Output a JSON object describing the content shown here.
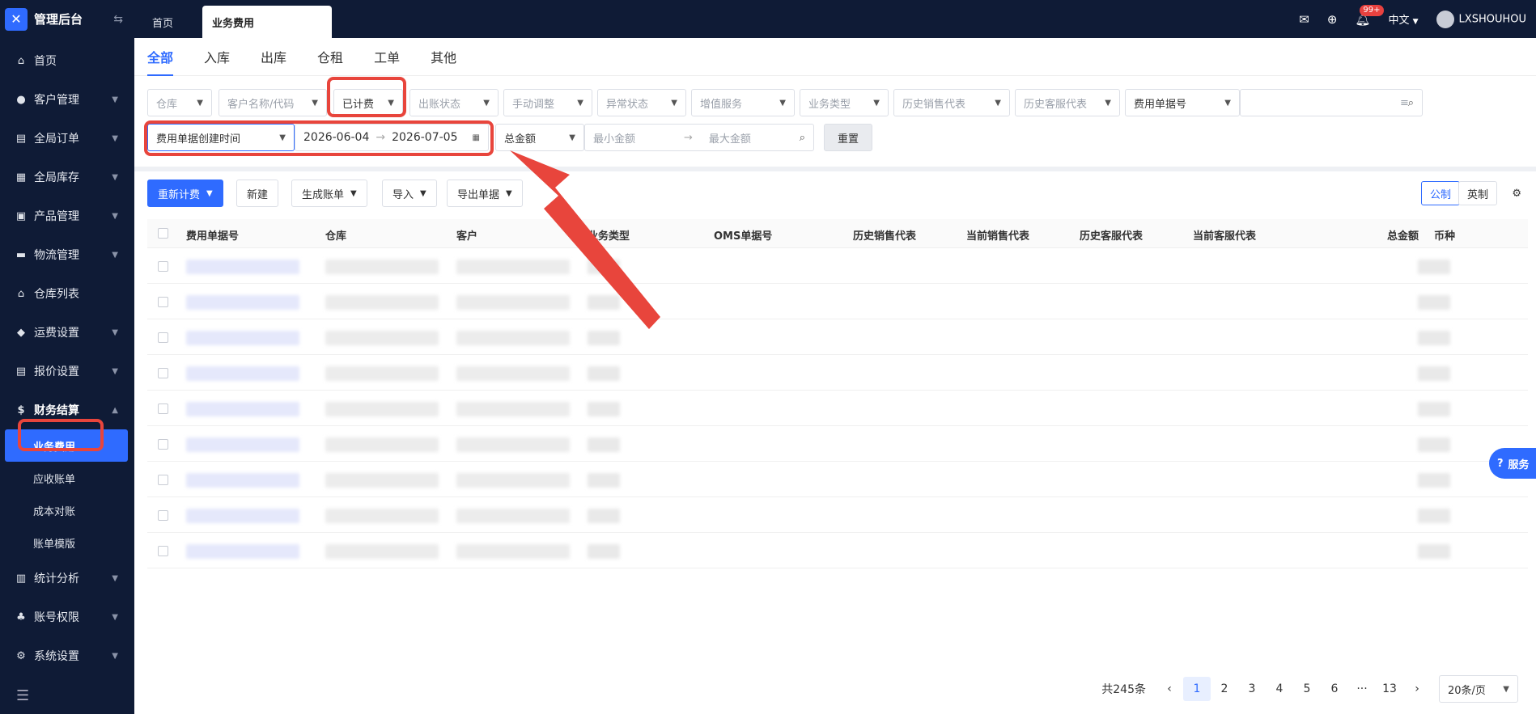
{
  "app": {
    "title": "管理后台"
  },
  "top_tabs": [
    {
      "label": "首页"
    },
    {
      "label": "业务费用"
    }
  ],
  "top_right": {
    "badge": "99+",
    "language": "中文",
    "username": "LXSHOUHOU"
  },
  "sidebar": {
    "items": [
      {
        "label": "首页",
        "icon": "home-icon"
      },
      {
        "label": "客户管理",
        "icon": "users-icon"
      },
      {
        "label": "全局订单",
        "icon": "order-icon"
      },
      {
        "label": "全局库存",
        "icon": "inventory-icon"
      },
      {
        "label": "产品管理",
        "icon": "product-icon"
      },
      {
        "label": "物流管理",
        "icon": "truck-icon"
      },
      {
        "label": "仓库列表",
        "icon": "warehouse-icon"
      },
      {
        "label": "运费设置",
        "icon": "freight-icon"
      },
      {
        "label": "报价设置",
        "icon": "quote-icon"
      },
      {
        "label": "财务结算",
        "icon": "finance-icon"
      },
      {
        "label": "统计分析",
        "icon": "stats-icon"
      },
      {
        "label": "账号权限",
        "icon": "permission-icon"
      },
      {
        "label": "系统设置",
        "icon": "settings-icon"
      }
    ],
    "finance_sub": [
      {
        "label": "业务费用"
      },
      {
        "label": "应收账单"
      },
      {
        "label": "成本对账"
      },
      {
        "label": "账单模版"
      }
    ]
  },
  "content_tabs": [
    {
      "label": "全部"
    },
    {
      "label": "入库"
    },
    {
      "label": "出库"
    },
    {
      "label": "仓租"
    },
    {
      "label": "工单"
    },
    {
      "label": "其他"
    }
  ],
  "filters_row1": {
    "warehouse": "仓库",
    "customer": "客户名称/代码",
    "billing_status": "已计费",
    "invoice_status": "出账状态",
    "manual_adjust": "手动调整",
    "exception_status": "异常状态",
    "value_added": "增值服务",
    "business_type": "业务类型",
    "hist_sales": "历史销售代表",
    "hist_cs": "历史客服代表",
    "doc_no_type": "费用单据号"
  },
  "filters_row2": {
    "date_type": "费用单据创建时间",
    "date_start": "2026-06-04",
    "date_end": "2026-07-05",
    "amount_type": "总金额",
    "min_amount": "最小金额",
    "max_amount": "最大金额",
    "reset": "重置"
  },
  "actions": {
    "recalc": "重新计费",
    "new": "新建",
    "gen_bill": "生成账单",
    "import": "导入",
    "export": "导出单据",
    "metric": "公制",
    "imperial": "英制"
  },
  "table": {
    "columns": [
      "费用单据号",
      "仓库",
      "客户",
      "业务类型",
      "OMS单据号",
      "历史销售代表",
      "当前销售代表",
      "历史客服代表",
      "当前客服代表",
      "总金额",
      "币种"
    ]
  },
  "pagination": {
    "total": "共245条",
    "pages": [
      "1",
      "2",
      "3",
      "4",
      "5",
      "6",
      "···",
      "13"
    ],
    "page_size": "20条/页"
  },
  "service": {
    "label": "服务"
  }
}
